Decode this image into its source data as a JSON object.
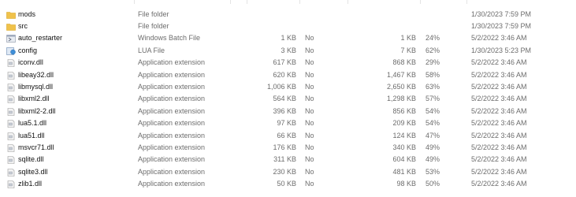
{
  "files": [
    {
      "name": "mods",
      "type": "File folder",
      "size": "",
      "compressed": "",
      "original_size": "",
      "ratio": "",
      "modified": "1/30/2023 7:59 PM",
      "icon": "folder-icon"
    },
    {
      "name": "src",
      "type": "File folder",
      "size": "",
      "compressed": "",
      "original_size": "",
      "ratio": "",
      "modified": "1/30/2023 7:59 PM",
      "icon": "folder-icon"
    },
    {
      "name": "auto_restarter",
      "type": "Windows Batch File",
      "size": "1 KB",
      "compressed": "No",
      "original_size": "1 KB",
      "ratio": "24%",
      "modified": "5/2/2022 3:46 AM",
      "icon": "batch-file-icon"
    },
    {
      "name": "config",
      "type": "LUA File",
      "size": "3 KB",
      "compressed": "No",
      "original_size": "7 KB",
      "ratio": "62%",
      "modified": "1/30/2023 5:23 PM",
      "icon": "lua-file-icon"
    },
    {
      "name": "iconv.dll",
      "type": "Application extension",
      "size": "617 KB",
      "compressed": "No",
      "original_size": "868 KB",
      "ratio": "29%",
      "modified": "5/2/2022 3:46 AM",
      "icon": "dll-file-icon"
    },
    {
      "name": "libeay32.dll",
      "type": "Application extension",
      "size": "620 KB",
      "compressed": "No",
      "original_size": "1,467 KB",
      "ratio": "58%",
      "modified": "5/2/2022 3:46 AM",
      "icon": "dll-file-icon"
    },
    {
      "name": "libmysql.dll",
      "type": "Application extension",
      "size": "1,006 KB",
      "compressed": "No",
      "original_size": "2,650 KB",
      "ratio": "63%",
      "modified": "5/2/2022 3:46 AM",
      "icon": "dll-file-icon"
    },
    {
      "name": "libxml2.dll",
      "type": "Application extension",
      "size": "564 KB",
      "compressed": "No",
      "original_size": "1,298 KB",
      "ratio": "57%",
      "modified": "5/2/2022 3:46 AM",
      "icon": "dll-file-icon"
    },
    {
      "name": "libxml2-2.dll",
      "type": "Application extension",
      "size": "396 KB",
      "compressed": "No",
      "original_size": "856 KB",
      "ratio": "54%",
      "modified": "5/2/2022 3:46 AM",
      "icon": "dll-file-icon"
    },
    {
      "name": "lua5.1.dll",
      "type": "Application extension",
      "size": "97 KB",
      "compressed": "No",
      "original_size": "209 KB",
      "ratio": "54%",
      "modified": "5/2/2022 3:46 AM",
      "icon": "dll-file-icon"
    },
    {
      "name": "lua51.dll",
      "type": "Application extension",
      "size": "66 KB",
      "compressed": "No",
      "original_size": "124 KB",
      "ratio": "47%",
      "modified": "5/2/2022 3:46 AM",
      "icon": "dll-file-icon"
    },
    {
      "name": "msvcr71.dll",
      "type": "Application extension",
      "size": "176 KB",
      "compressed": "No",
      "original_size": "340 KB",
      "ratio": "49%",
      "modified": "5/2/2022 3:46 AM",
      "icon": "dll-file-icon"
    },
    {
      "name": "sqlite.dll",
      "type": "Application extension",
      "size": "311 KB",
      "compressed": "No",
      "original_size": "604 KB",
      "ratio": "49%",
      "modified": "5/2/2022 3:46 AM",
      "icon": "dll-file-icon"
    },
    {
      "name": "sqlite3.dll",
      "type": "Application extension",
      "size": "230 KB",
      "compressed": "No",
      "original_size": "481 KB",
      "ratio": "53%",
      "modified": "5/2/2022 3:46 AM",
      "icon": "dll-file-icon"
    },
    {
      "name": "zlib1.dll",
      "type": "Application extension",
      "size": "50 KB",
      "compressed": "No",
      "original_size": "98 KB",
      "ratio": "50%",
      "modified": "5/2/2022 3:46 AM",
      "icon": "dll-file-icon"
    }
  ],
  "colors": {
    "folder": "#f0c24b",
    "folder_dark": "#d9a521",
    "text_secondary": "#6d6d6d",
    "text_primary": "#111111"
  }
}
